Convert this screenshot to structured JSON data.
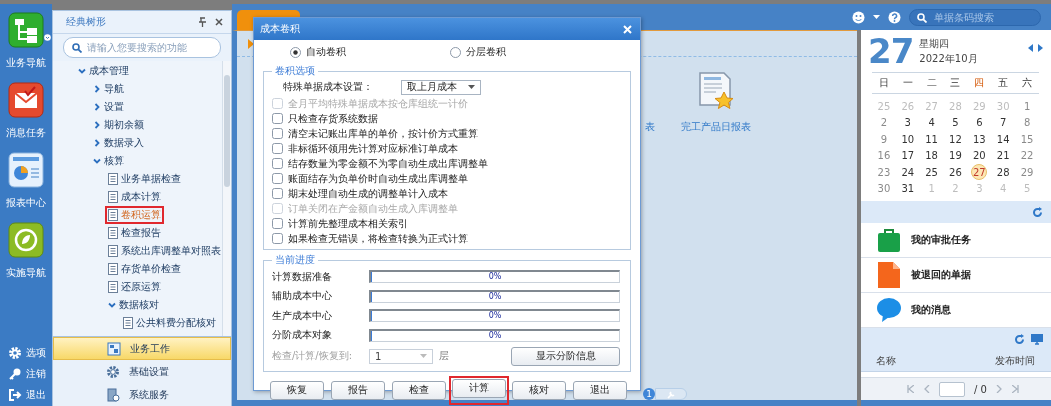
{
  "nav_rail": {
    "items": [
      {
        "label": "业务导航",
        "kind": "tree"
      },
      {
        "label": "消息任务",
        "kind": "mail"
      },
      {
        "label": "报表中心",
        "kind": "report"
      },
      {
        "label": "实施导航",
        "kind": "compass"
      }
    ],
    "footer": [
      {
        "label": "选项",
        "kind": "gear"
      },
      {
        "label": "注销",
        "kind": "key"
      },
      {
        "label": "退出",
        "kind": "exit"
      }
    ]
  },
  "tree_panel": {
    "title": "经典树形",
    "search": {
      "placeholder": "请输入您要搜索的功能"
    },
    "tree": [
      {
        "label": "成本管理",
        "kind": "folder",
        "expanded": true,
        "selected": false,
        "children": [
          {
            "label": "导航",
            "kind": "folder",
            "expanded": false,
            "selected": false
          },
          {
            "label": "设置",
            "kind": "folder",
            "expanded": false,
            "selected": false
          },
          {
            "label": "期初余额",
            "kind": "folder",
            "expanded": false,
            "selected": false
          },
          {
            "label": "数据录入",
            "kind": "folder",
            "expanded": false,
            "selected": false
          },
          {
            "label": "核算",
            "kind": "folder",
            "expanded": true,
            "selected": false,
            "children": [
              {
                "label": "业务单据检查",
                "kind": "page",
                "selected": false
              },
              {
                "label": "成本计算",
                "kind": "page",
                "selected": false
              },
              {
                "label": "卷积运算",
                "kind": "page",
                "selected": true
              },
              {
                "label": "检查报告",
                "kind": "page",
                "selected": false
              },
              {
                "label": "系统出库调整单对照表",
                "kind": "page",
                "selected": false
              },
              {
                "label": "存货单价检查",
                "kind": "page",
                "selected": false
              },
              {
                "label": "还原运算",
                "kind": "page",
                "selected": false
              },
              {
                "label": "数据核对",
                "kind": "folder",
                "expanded": true,
                "selected": false,
                "children": [
                  {
                    "label": "公共料费分配核对",
                    "kind": "page",
                    "selected": false
                  }
                ]
              }
            ]
          }
        ]
      }
    ],
    "modules": [
      {
        "label": "业务工作",
        "kind": "work",
        "selected": true
      },
      {
        "label": "基础设置",
        "kind": "gear",
        "selected": false
      },
      {
        "label": "系统服务",
        "kind": "service",
        "selected": false
      }
    ]
  },
  "top_bar": {
    "search": {
      "placeholder": "单据条码搜索"
    }
  },
  "desktop": {
    "items": [
      {
        "label": "表",
        "kind": "hidden"
      },
      {
        "label": "完工产品日报表",
        "kind": "report"
      }
    ],
    "page": "1"
  },
  "dialog": {
    "title": "成本卷积",
    "modes": [
      {
        "label": "自动卷积",
        "selected": true
      },
      {
        "label": "分层卷积",
        "selected": false
      }
    ],
    "options": {
      "title": "卷积选项",
      "setting_label": "特殊单据成本设置：",
      "setting_value": "取上月成本",
      "checkboxes": [
        {
          "label": "全月平均特殊单据成本按仓库组统一计价",
          "checked": false,
          "disabled": true
        },
        {
          "label": "只检查存货系统数据",
          "checked": false,
          "disabled": false
        },
        {
          "label": "清空未记账出库单的单价，按计价方式重算",
          "checked": false,
          "disabled": false
        },
        {
          "label": "非标循环领用先计算对应标准订单成本",
          "checked": false,
          "disabled": false
        },
        {
          "label": "结存数量为零金额不为零自动生成出库调整单",
          "checked": false,
          "disabled": false
        },
        {
          "label": "账面结存为负单价时自动生成出库调整单",
          "checked": false,
          "disabled": false
        },
        {
          "label": "期末处理自动生成的调整单计入成本",
          "checked": false,
          "disabled": false
        },
        {
          "label": "订单关闭在产金额自动生成入库调整单",
          "checked": false,
          "disabled": true
        },
        {
          "label": "计算前先整理成本相关索引",
          "checked": false,
          "disabled": false
        },
        {
          "label": "如果检查无错误，将检查转换为正式计算",
          "checked": false,
          "disabled": false
        }
      ]
    },
    "progress": {
      "title": "当前进度",
      "rows": [
        {
          "name": "计算数据准备",
          "level": 0,
          "reading": "0%"
        },
        {
          "name": "辅助成本中心",
          "level": 0,
          "reading": "0%"
        },
        {
          "name": "生产成本中心",
          "level": 0,
          "reading": "0%"
        },
        {
          "name": "分阶成本对象",
          "level": 0,
          "reading": "0%"
        }
      ],
      "level_label": "检查/计算/恢复到:",
      "level_value": "1",
      "level_unit": "层",
      "level_disabled": true,
      "detail_button": "显示分阶信息"
    },
    "buttons": [
      {
        "label": "恢复",
        "highlighted": false
      },
      {
        "label": "报告",
        "highlighted": false
      },
      {
        "label": "检查",
        "highlighted": false
      },
      {
        "label": "计算",
        "highlighted": true
      },
      {
        "label": "核对",
        "highlighted": false
      },
      {
        "label": "退出",
        "highlighted": false
      }
    ]
  },
  "calendar": {
    "day": "27",
    "weekday": "星期四",
    "month": "2022年10月",
    "weekdays": [
      {
        "label": "日",
        "selected": false
      },
      {
        "label": "一",
        "selected": false
      },
      {
        "label": "二",
        "selected": false
      },
      {
        "label": "三",
        "selected": false
      },
      {
        "label": "四",
        "selected": true
      },
      {
        "label": "五",
        "selected": false
      },
      {
        "label": "六",
        "selected": false
      }
    ],
    "days": [
      {
        "d": "25",
        "kind": "other",
        "selected": false
      },
      {
        "d": "26",
        "kind": "other",
        "selected": false
      },
      {
        "d": "27",
        "kind": "other",
        "selected": false
      },
      {
        "d": "28",
        "kind": "other",
        "selected": false
      },
      {
        "d": "29",
        "kind": "other",
        "selected": false
      },
      {
        "d": "30",
        "kind": "other",
        "selected": false
      },
      {
        "d": "1",
        "kind": "weekend",
        "selected": false
      },
      {
        "d": "2",
        "kind": "weekend",
        "selected": false
      },
      {
        "d": "3",
        "kind": "weekday",
        "selected": false
      },
      {
        "d": "4",
        "kind": "weekday",
        "selected": false
      },
      {
        "d": "5",
        "kind": "weekday",
        "selected": false
      },
      {
        "d": "6",
        "kind": "weekday",
        "selected": false
      },
      {
        "d": "7",
        "kind": "weekday",
        "selected": false
      },
      {
        "d": "8",
        "kind": "weekend",
        "selected": false
      },
      {
        "d": "9",
        "kind": "weekend",
        "selected": false
      },
      {
        "d": "10",
        "kind": "weekday",
        "selected": false
      },
      {
        "d": "11",
        "kind": "weekday",
        "selected": false
      },
      {
        "d": "12",
        "kind": "weekday",
        "selected": false
      },
      {
        "d": "13",
        "kind": "weekday",
        "selected": false
      },
      {
        "d": "14",
        "kind": "weekday",
        "selected": false
      },
      {
        "d": "15",
        "kind": "weekend",
        "selected": false
      },
      {
        "d": "16",
        "kind": "weekend",
        "selected": false
      },
      {
        "d": "17",
        "kind": "weekday",
        "selected": false
      },
      {
        "d": "18",
        "kind": "weekday",
        "selected": false
      },
      {
        "d": "19",
        "kind": "weekday",
        "selected": false
      },
      {
        "d": "20",
        "kind": "weekday",
        "selected": false
      },
      {
        "d": "21",
        "kind": "weekday",
        "selected": false
      },
      {
        "d": "22",
        "kind": "weekend",
        "selected": false
      },
      {
        "d": "23",
        "kind": "weekend",
        "selected": false
      },
      {
        "d": "24",
        "kind": "weekday",
        "selected": false
      },
      {
        "d": "25",
        "kind": "weekday",
        "selected": false
      },
      {
        "d": "26",
        "kind": "weekday",
        "selected": false
      },
      {
        "d": "27",
        "kind": "weekday",
        "selected": true
      },
      {
        "d": "28",
        "kind": "weekday",
        "selected": false
      },
      {
        "d": "29",
        "kind": "weekend",
        "selected": false
      },
      {
        "d": "30",
        "kind": "weekend",
        "selected": false
      },
      {
        "d": "31",
        "kind": "weekday",
        "selected": false
      },
      {
        "d": "1",
        "kind": "other",
        "selected": false
      },
      {
        "d": "2",
        "kind": "other",
        "selected": false
      },
      {
        "d": "3",
        "kind": "other",
        "selected": false
      },
      {
        "d": "4",
        "kind": "other",
        "selected": false
      },
      {
        "d": "5",
        "kind": "other",
        "selected": false
      }
    ]
  },
  "tasks": [
    {
      "label": "我的审批任务",
      "kind": "briefcase"
    },
    {
      "label": "被退回的单据",
      "kind": "document"
    },
    {
      "label": "我的消息",
      "kind": "bubble"
    }
  ],
  "notices": {
    "columns": [
      "名称",
      "发布时间"
    ],
    "pager": "/ 0"
  }
}
